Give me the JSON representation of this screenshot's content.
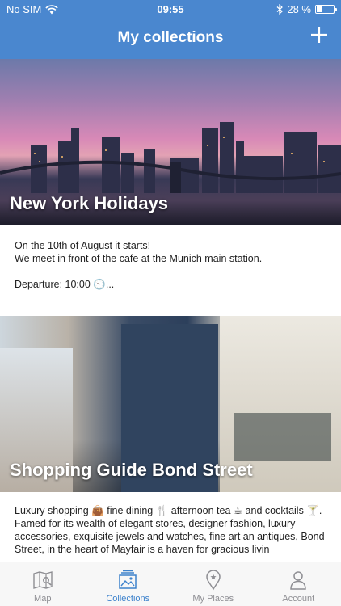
{
  "status_bar": {
    "carrier": "No SIM",
    "time": "09:55",
    "battery_text": "28 %",
    "battery_level": 0.28
  },
  "header": {
    "title": "My collections",
    "add_icon": "plus-icon"
  },
  "collections": [
    {
      "title": "New York Holidays",
      "lines": [
        "On the 10th of August it starts!",
        "We meet in front of the cafe at the Munich main station.",
        "Departure: 10:00 🕙..."
      ]
    },
    {
      "title": "Shopping Guide Bond Street",
      "lines": [
        "Luxury shopping 👜 fine dining 🍴 afternoon tea ☕ and cocktails 🍸.",
        "Famed for its wealth of elegant stores, designer fashion, luxury accessories, exquisite jewels and watches, fine art an antiques, Bond Street, in the heart of Mayfair is a haven for gracious livin"
      ]
    }
  ],
  "tabs": [
    {
      "label": "Map",
      "icon": "map-icon",
      "active": false
    },
    {
      "label": "Collections",
      "icon": "collections-icon",
      "active": true
    },
    {
      "label": "My Places",
      "icon": "location-pin-icon",
      "active": false
    },
    {
      "label": "Account",
      "icon": "person-icon",
      "active": false
    }
  ],
  "colors": {
    "header_bg": "#4a87cf",
    "tab_active": "#3d82cc",
    "tab_inactive": "#8e8e93"
  }
}
